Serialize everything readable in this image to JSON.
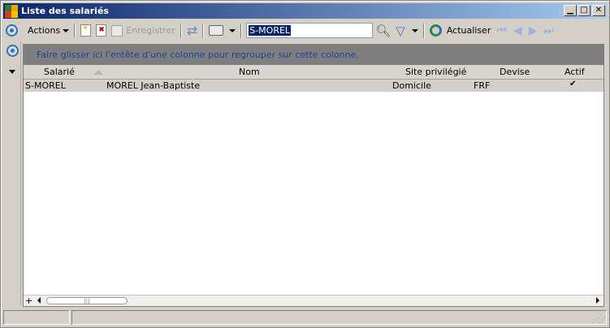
{
  "window": {
    "title": "Liste des salariés"
  },
  "toolbar": {
    "actions_label": "Actions",
    "save_label": "Enregistrer",
    "search_value": "S-MOREL",
    "refresh_label": "Actualiser"
  },
  "grid": {
    "group_hint": "Faire glisser ici l'entête d'une colonne pour regrouper sur cette colonne.",
    "columns": [
      "Salarié",
      "Nom",
      "Site privilégié",
      "Devise",
      "Actif"
    ],
    "rows": [
      {
        "salarie": "S-MOREL",
        "nom": "MOREL Jean-Baptiste",
        "site": "Domicile",
        "devise": "FRF",
        "actif": "✔"
      }
    ]
  },
  "icons": [
    "app-icon",
    "circle-menu-icon",
    "new-icon",
    "delete-icon",
    "save-icon",
    "refresh-icon",
    "print-icon",
    "search-icon",
    "filter-icon",
    "reload-icon",
    "first-icon",
    "prev-icon",
    "next-icon",
    "last-icon"
  ],
  "colors": {
    "titlebar_start": "#0a246a",
    "titlebar_end": "#a6caf0",
    "group_panel": "#7f7f7f",
    "selected_row": "#d4d0c8"
  }
}
